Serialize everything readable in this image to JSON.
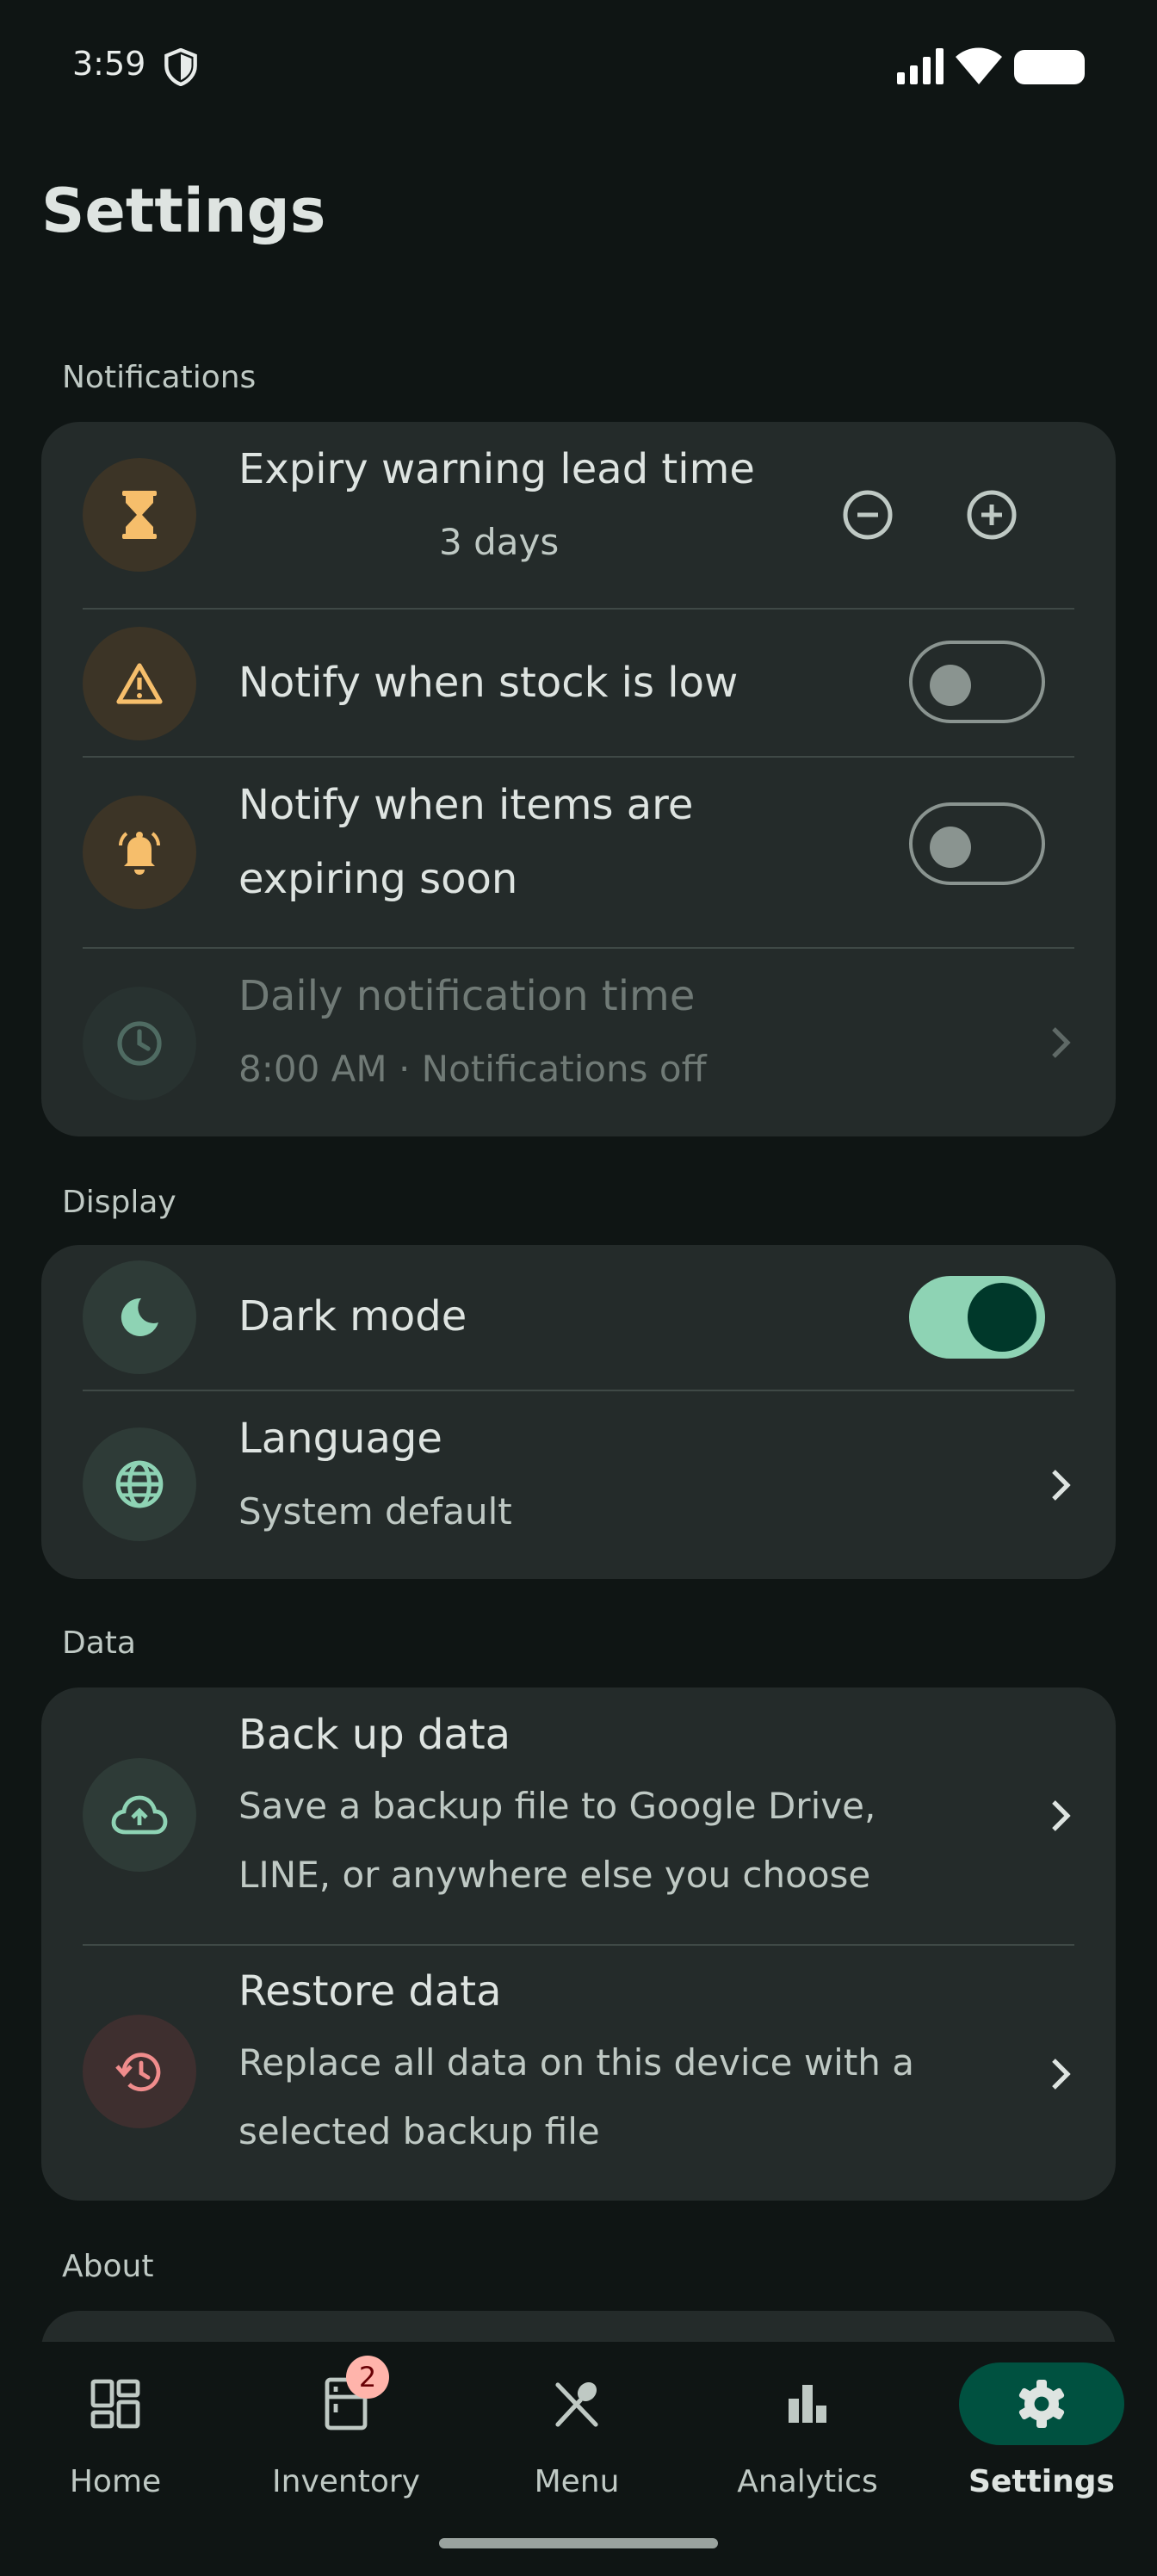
{
  "status_bar": {
    "time": "3:59"
  },
  "page": {
    "title": "Settings"
  },
  "sections": {
    "notifications": {
      "label": "Notifications",
      "expiry": {
        "title": "Expiry warning lead time",
        "value": "3 days"
      },
      "stock_low": {
        "title": "Notify when stock is low",
        "enabled": false
      },
      "expiring": {
        "title_line1": "Notify when items are",
        "title_line2": "expiring soon",
        "enabled": false
      },
      "daily_time": {
        "title": "Daily notification time",
        "subtitle": "8:00 AM · Notifications off"
      }
    },
    "display": {
      "label": "Display",
      "dark_mode": {
        "title": "Dark mode",
        "enabled": true
      },
      "language": {
        "title": "Language",
        "subtitle": "System default"
      }
    },
    "data": {
      "label": "Data",
      "backup": {
        "title": "Back up data",
        "subtitle_line1": "Save a backup file to Google Drive,",
        "subtitle_line2": "LINE, or anywhere else you choose"
      },
      "restore": {
        "title": "Restore data",
        "subtitle_line1": "Replace all data on this device with a",
        "subtitle_line2": "selected backup file"
      }
    },
    "about": {
      "label": "About"
    }
  },
  "nav": {
    "items": [
      {
        "label": "Home",
        "icon": "dashboard-icon"
      },
      {
        "label": "Inventory",
        "icon": "fridge-icon",
        "badge": "2"
      },
      {
        "label": "Menu",
        "icon": "utensils-icon"
      },
      {
        "label": "Analytics",
        "icon": "bar-chart-icon"
      },
      {
        "label": "Settings",
        "icon": "gear-icon",
        "active": true
      }
    ]
  },
  "colors": {
    "background": "#0f1514",
    "card": "#242b2a",
    "accent": "#8ed3b4",
    "amber_icon": "#f6be6b",
    "red_icon": "#f08c8c"
  }
}
